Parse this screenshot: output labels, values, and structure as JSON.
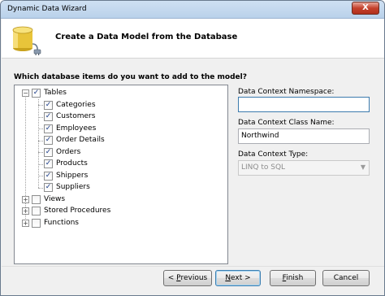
{
  "window": {
    "title": "Dynamic Data Wizard",
    "close_label": "X"
  },
  "header": {
    "title": "Create a Data Model from the Database",
    "icon": "database-connect-icon"
  },
  "question": "Which database items do you want to add to the model?",
  "tree": {
    "tables": {
      "label": "Tables",
      "checked": true,
      "expanded": true,
      "items": [
        "Categories",
        "Customers",
        "Employees",
        "Order Details",
        "Orders",
        "Products",
        "Shippers",
        "Suppliers"
      ]
    },
    "views": {
      "label": "Views",
      "checked": false
    },
    "stored_procedures": {
      "label": "Stored Procedures",
      "checked": false
    },
    "functions": {
      "label": "Functions",
      "checked": false
    }
  },
  "form": {
    "namespace_label": "Data Context Namespace:",
    "namespace_value": "",
    "classname_label": "Data Context Class Name:",
    "classname_value": "Northwind",
    "type_label": "Data Context Type:",
    "type_value": "LINQ to SQL"
  },
  "buttons": {
    "previous": {
      "prefix": "< ",
      "mnemonic": "P",
      "rest": "revious"
    },
    "next": {
      "mnemonic": "N",
      "rest": "ext >"
    },
    "finish": {
      "mnemonic": "F",
      "rest": "inish"
    },
    "cancel": "Cancel"
  }
}
